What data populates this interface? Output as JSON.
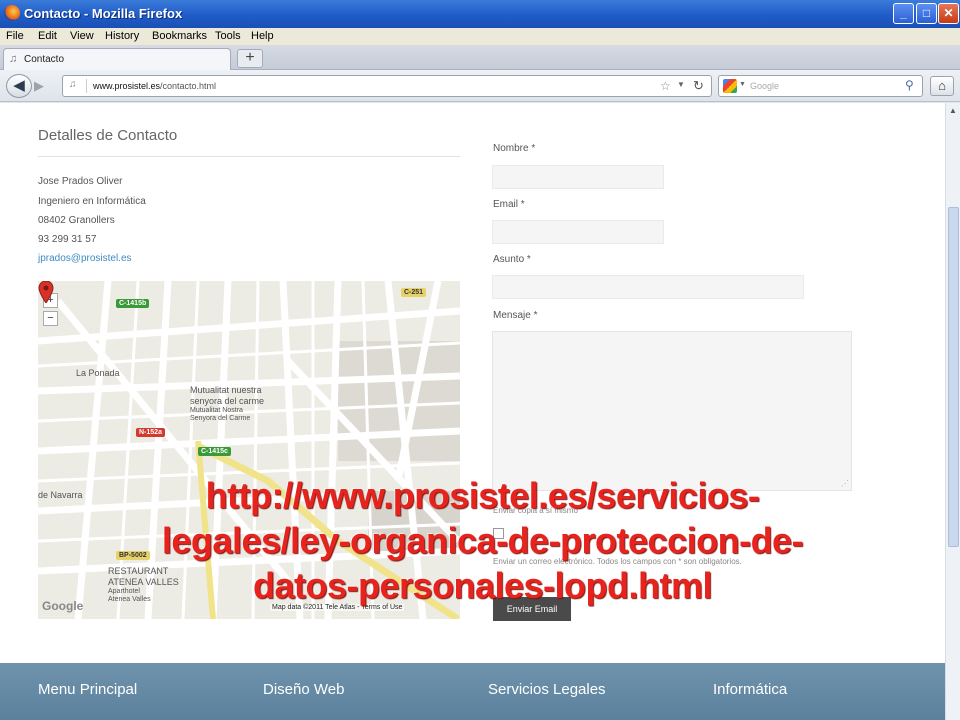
{
  "window": {
    "title": "Contacto - Mozilla Firefox",
    "controls": {
      "minimize": "_",
      "maximize": "□",
      "close": "✕"
    }
  },
  "menu": [
    "File",
    "Edit",
    "View",
    "History",
    "Bookmarks",
    "Tools",
    "Help"
  ],
  "tabs": [
    {
      "label": "Contacto",
      "icon": "page-icon"
    }
  ],
  "new_tab_label": "+",
  "nav": {
    "url_domain": "www.prosistel.es",
    "url_path": "/contacto.html",
    "search_placeholder": "Google"
  },
  "contact": {
    "heading": "Detalles de Contacto",
    "name": "Jose Prados Oliver",
    "role": "Ingeniero en Informática",
    "city": "08402 Granollers",
    "phone": "93 299 31 57",
    "email": "jprados@prosistel.es"
  },
  "map": {
    "zoom_in": "+",
    "zoom_out": "−",
    "badges": [
      {
        "text": "C-1415b",
        "color": "green"
      },
      {
        "text": "C-251",
        "color": "yellow"
      },
      {
        "text": "N-152a",
        "color": "red"
      },
      {
        "text": "C-1415c",
        "color": "green"
      },
      {
        "text": "BP-5002",
        "color": "yellow"
      }
    ],
    "labels": {
      "ponada": "La Ponada",
      "mutualitat1": "Mutualitat nuestra",
      "mutualitat2": "senyora del carme",
      "mutualitat3": "Mutualitat Nostra",
      "mutualitat4": "Senyora del Carme",
      "navarra": "de Navarra",
      "restaurant1": "RESTAURANT",
      "restaurant2": "ATENEA VALLES",
      "restaurant3": "Aparthotel",
      "restaurant4": "Atenea Valles"
    },
    "google": "Google",
    "copyright": "Map data ©2011 Tele Atlas - Terms of Use"
  },
  "form": {
    "nombre_label": "Nombre *",
    "email_label": "Email *",
    "asunto_label": "Asunto *",
    "mensaje_label": "Mensaje *",
    "copy_label": "Enviar copia a sí mismo",
    "required_note": "Enviar un correo electrónico. Todos los campos con * son obligatorios.",
    "submit_label": "Enviar Email"
  },
  "overlay": {
    "line1": "http://www.prosistel.es/servicios-",
    "line2": "legales/ley-organica-de-proteccion-de-",
    "line3": "datos-personales-lopd.html"
  },
  "footer": [
    "Menu Principal",
    "Diseño Web",
    "Servicios Legales",
    "Informática"
  ],
  "colors": {
    "titlebar": "#1f5cc8",
    "footer": "#6f93ad",
    "overlay_text": "#e8231d",
    "email_link": "#3e8bc5",
    "submit_bg": "#4a4a4a"
  }
}
